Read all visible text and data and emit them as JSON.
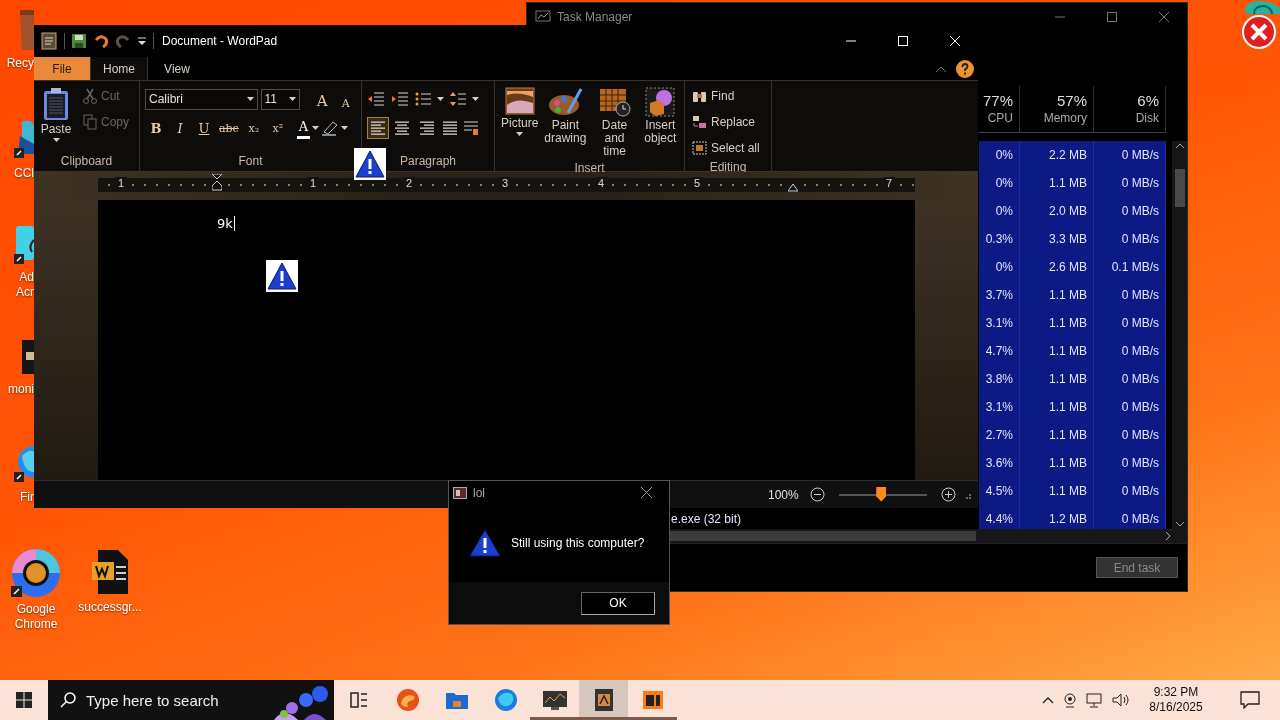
{
  "desktop": {
    "icons": [
      {
        "kind": "recycle",
        "label": "Recy"
      },
      {
        "kind": "ccleaner",
        "label": "CCl"
      },
      {
        "kind": "acrobat",
        "label": "Ad Acr"
      },
      {
        "kind": "monitor",
        "label": "moni"
      },
      {
        "kind": "firefox",
        "label": "Fir"
      },
      {
        "kind": "chrome",
        "label": "Google Chrome"
      },
      {
        "kind": "document",
        "label": "successgr..."
      }
    ]
  },
  "task_manager": {
    "title": "Task Manager",
    "columns": [
      {
        "percent": "77%",
        "name": "CPU"
      },
      {
        "percent": "57%",
        "name": "Memory"
      },
      {
        "percent": "6%",
        "name": "Disk"
      }
    ],
    "rows": [
      {
        "cpu": "0%",
        "memory": "2.2 MB",
        "disk": "0 MB/s"
      },
      {
        "cpu": "0%",
        "memory": "1.1 MB",
        "disk": "0 MB/s"
      },
      {
        "cpu": "0%",
        "memory": "2.0 MB",
        "disk": "0 MB/s"
      },
      {
        "cpu": "0.3%",
        "memory": "3.3 MB",
        "disk": "0 MB/s"
      },
      {
        "cpu": "0%",
        "memory": "2.6 MB",
        "disk": "0.1 MB/s"
      },
      {
        "cpu": "3.7%",
        "memory": "1.1 MB",
        "disk": "0 MB/s"
      },
      {
        "cpu": "3.1%",
        "memory": "1.1 MB",
        "disk": "0 MB/s"
      },
      {
        "cpu": "4.7%",
        "memory": "1.1 MB",
        "disk": "0 MB/s"
      },
      {
        "cpu": "3.8%",
        "memory": "1.1 MB",
        "disk": "0 MB/s"
      },
      {
        "cpu": "3.1%",
        "memory": "1.1 MB",
        "disk": "0 MB/s"
      },
      {
        "cpu": "2.7%",
        "memory": "1.1 MB",
        "disk": "0 MB/s"
      },
      {
        "cpu": "3.6%",
        "memory": "1.1 MB",
        "disk": "0 MB/s"
      },
      {
        "cpu": "4.5%",
        "memory": "1.1 MB",
        "disk": "0 MB/s"
      },
      {
        "cpu": "4.4%",
        "memory": "1.2 MB",
        "disk": "0 MB/s",
        "name": "e.exe (32 bit)"
      }
    ],
    "end_task": {
      "label": "End task",
      "disabled": true
    }
  },
  "wordpad": {
    "title": "Document - WordPad",
    "tabs": [
      {
        "label": "File",
        "kind": "file",
        "selected": false
      },
      {
        "label": "Home",
        "kind": "tab",
        "selected": true
      },
      {
        "label": "View",
        "kind": "tab",
        "selected": false
      }
    ],
    "clipboard": {
      "label": "Clipboard",
      "paste": "Paste",
      "items": [
        {
          "kind": "cut",
          "label": "Cut",
          "disabled": true
        },
        {
          "kind": "copy",
          "label": "Copy",
          "disabled": true
        }
      ]
    },
    "font": {
      "label": "Font",
      "family": "Calibri",
      "size": "11",
      "size_buttons": [
        {
          "kind": "grow",
          "label": "A"
        },
        {
          "kind": "shrink",
          "label": "A"
        }
      ],
      "format_buttons": [
        {
          "kind": "bold",
          "label": "B"
        },
        {
          "kind": "italic",
          "label": "I"
        },
        {
          "kind": "underline",
          "label": "U"
        },
        {
          "kind": "strike",
          "label": "abc"
        },
        {
          "kind": "subscript",
          "label": "x₂"
        },
        {
          "kind": "superscript",
          "label": "x²"
        }
      ],
      "color_button": {
        "label": "A"
      }
    },
    "paragraph": {
      "label": "Paragraph",
      "align": [
        {
          "kind": "left",
          "selected": true
        },
        {
          "kind": "center",
          "selected": false
        },
        {
          "kind": "right",
          "selected": false
        },
        {
          "kind": "justify",
          "selected": false
        }
      ]
    },
    "insert": {
      "label": "Insert",
      "buttons": [
        {
          "kind": "picture",
          "label": "Picture"
        },
        {
          "kind": "paint",
          "label": "Paint drawing"
        },
        {
          "kind": "datetime",
          "label": "Date and time"
        },
        {
          "kind": "object",
          "label": "Insert object"
        }
      ]
    },
    "editing": {
      "label": "Editing",
      "buttons": [
        {
          "kind": "find",
          "label": "Find"
        },
        {
          "kind": "replace",
          "label": "Replace"
        },
        {
          "kind": "select",
          "label": "Select all"
        }
      ]
    },
    "ruler": [
      {
        "kind": "number",
        "label": "1"
      },
      {
        "kind": "left-indent"
      },
      {
        "kind": "number",
        "label": "1"
      },
      {
        "kind": "number",
        "label": "2"
      },
      {
        "kind": "number",
        "label": "3"
      },
      {
        "kind": "number",
        "label": "4"
      },
      {
        "kind": "number",
        "label": "5"
      },
      {
        "kind": "right-indent"
      },
      {
        "kind": "number",
        "label": "7"
      }
    ],
    "document_text": "9k",
    "zoom": {
      "reading": "100%",
      "level": 0.48
    }
  },
  "dialog": {
    "title": "lol",
    "message": "Still using this computer?",
    "button": "OK"
  },
  "taskbar": {
    "search_placeholder": "Type here to search",
    "apps": [
      {
        "kind": "task-view",
        "running": false,
        "selected": false
      },
      {
        "kind": "edge",
        "running": false,
        "selected": false
      },
      {
        "kind": "explorer",
        "running": false,
        "selected": false
      },
      {
        "kind": "firefox",
        "running": false,
        "selected": false
      },
      {
        "kind": "task-manager",
        "running": true,
        "selected": false
      },
      {
        "kind": "wordpad",
        "running": true,
        "selected": true
      },
      {
        "kind": "orange-app",
        "running": true,
        "selected": false
      }
    ],
    "time": "9:32 PM",
    "date": "8/16/2025"
  }
}
